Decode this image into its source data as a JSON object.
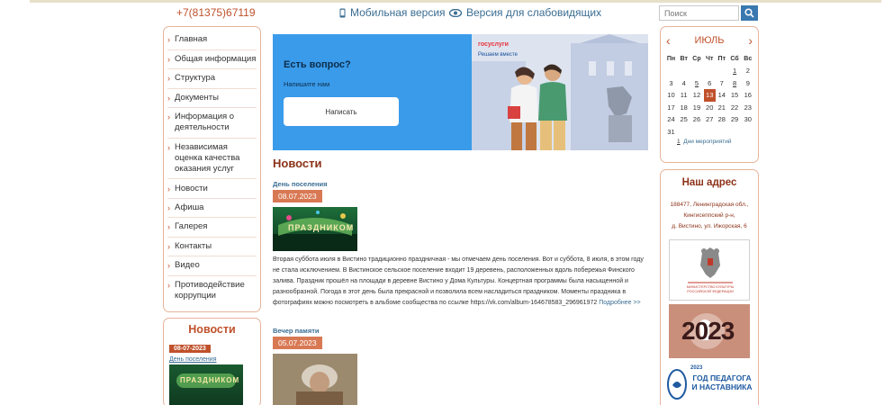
{
  "header": {
    "phone": "+7(81375)67119",
    "mobile_version": "Мобильная версия",
    "vision_version": "Версия для слабовидящих",
    "search_placeholder": "Поиск"
  },
  "left_menu": {
    "items": [
      "Главная",
      "Общая информация",
      "Структура",
      "Документы",
      "Информация о деятельности",
      "Независимая оценка качества оказания услуг",
      "Новости",
      "Афиша",
      "Галерея",
      "Контакты",
      "Видео",
      "Противодействие коррупции"
    ]
  },
  "left_news": {
    "title": "Новости",
    "date": "08-07-2023",
    "link": "День поселения"
  },
  "banner": {
    "question": "Есть вопрос?",
    "write_to_us": "Напишите нам",
    "button": "Написать",
    "brand": "госуслуги",
    "brand_slogan": "Решаем вместе"
  },
  "main": {
    "heading": "Новости",
    "news": [
      {
        "title": "День поселения",
        "date": "08.07.2023",
        "image_caption": "ПРАЗДНИКОМ",
        "text": "Вторая суббота июля в Вистино традиционно праздничная - мы отмечаем день поселения. Вот и суббота, 8 июля, в этом году не стала исключением. В Вистинское сельское поселение входит 19 деревень, расположенных вдоль побережья Финского залива. Праздник прошёл на площади в деревне Вистино у Дома Культуры. Концертная программы была насыщенной и разнообразной. Погода в этот день была прекрасной и позволила всем насладиться праздником. Моменты праздника в фотографиях можно посмотреть в альбоме сообщества по ссылке https://vk.com/album-164678583_296961972",
        "more": "Подробнее >>"
      },
      {
        "title": "Вечер памяти",
        "date": "05.07.2023"
      }
    ]
  },
  "calendar": {
    "month": "ИЮЛЬ",
    "prev": "‹",
    "next": "›",
    "weekdays": [
      "Пн",
      "Вт",
      "Ср",
      "Чт",
      "Пт",
      "Сб",
      "Вс"
    ],
    "weeks": [
      [
        "",
        "",
        "",
        "",
        "",
        "1",
        "2"
      ],
      [
        "3",
        "4",
        "5",
        "6",
        "7",
        "8",
        "9"
      ],
      [
        "10",
        "11",
        "12",
        "13",
        "14",
        "15",
        "16"
      ],
      [
        "17",
        "18",
        "19",
        "20",
        "21",
        "22",
        "23"
      ],
      [
        "24",
        "25",
        "26",
        "27",
        "28",
        "29",
        "30"
      ],
      [
        "31",
        "",
        "",
        "",
        "",
        "",
        ""
      ]
    ],
    "today": "13",
    "event_days": [
      "1",
      "5",
      "8"
    ],
    "footer_count": "1",
    "footer_label": "Дни мероприятий"
  },
  "address": {
    "title": "Наш адрес",
    "line1": "188477, Ленинградская обл.,",
    "line2": "Кингисеппский р-н,",
    "line3": "д. Вистино, ул. Ижорская, 6",
    "logo1_text": "МИНИСТЕРСТВО КУЛЬТУРЫ РОССИЙСКОЙ ФЕДЕРАЦИИ",
    "logo2_text": "2023",
    "logo3_year": "2023",
    "logo3_text": "ГОД ПЕДАГОГА И НАСТАВНИКА"
  }
}
